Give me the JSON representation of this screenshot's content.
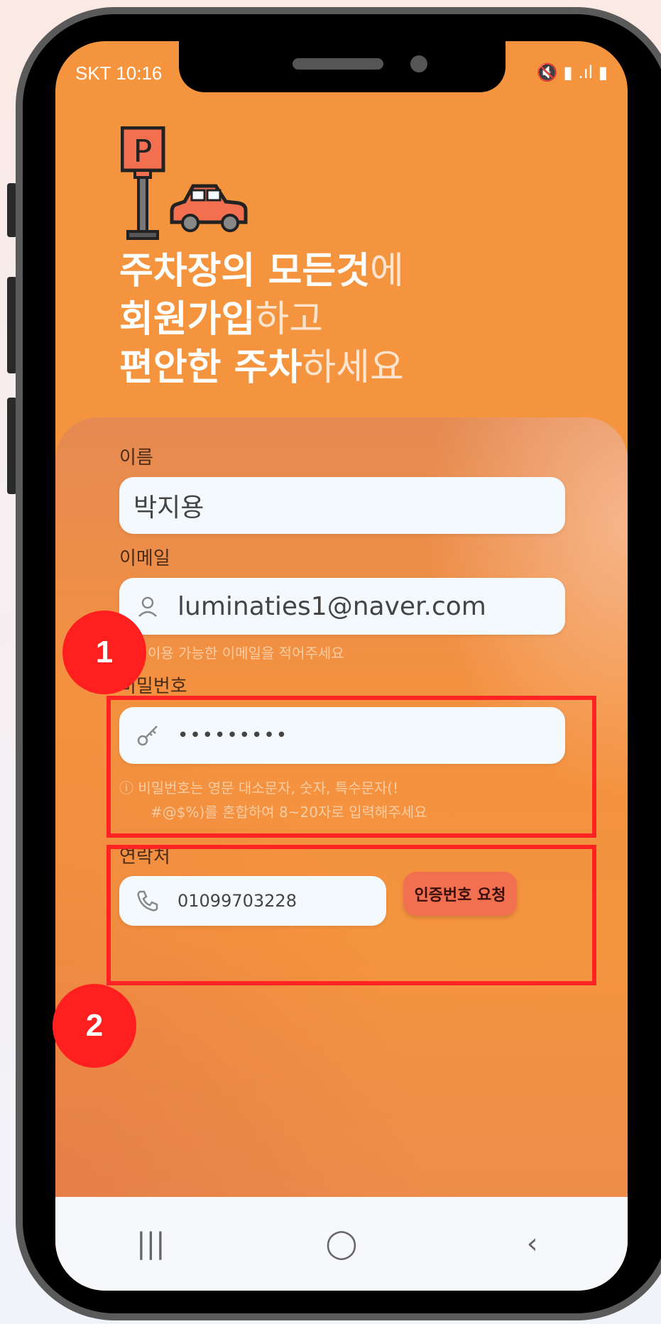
{
  "status_bar": {
    "carrier_time": "SKT 10:16",
    "icons": "🔇 ▮ .ıl ▮"
  },
  "headline": {
    "line1_bold": "주차장의 모든것",
    "line1_light": "에",
    "line2_bold": "회원가입",
    "line2_light": "하고",
    "line3_bold": "편안한 주차",
    "line3_light": "하세요"
  },
  "form": {
    "name_label": "이름",
    "name_value": "박지용",
    "email_label": "이메일",
    "email_value": "luminaties1@naver.com",
    "email_hint": "이용 가능한 이메일을 적어주세요",
    "password_label": "비밀번호",
    "password_value": "•••••••••",
    "password_hint_line1": "ⓘ 비밀번호는 영문 대소문자, 숫자, 특수문자(!",
    "password_hint_line2": "#@$%)를 혼합하여 8~20자로 입력해주세요",
    "phone_label": "연락처",
    "phone_value": "01099703228",
    "request_button": "인증번호 요청"
  },
  "navbar": {
    "recent": "|||",
    "home": "◯",
    "back": "‹"
  },
  "annotations": {
    "badge1": "1",
    "badge2": "2"
  },
  "colors": {
    "screen_bg": "#f5943e",
    "highlight": "#ff2323",
    "badge": "#ff1f1f",
    "button": "#f2704f"
  }
}
